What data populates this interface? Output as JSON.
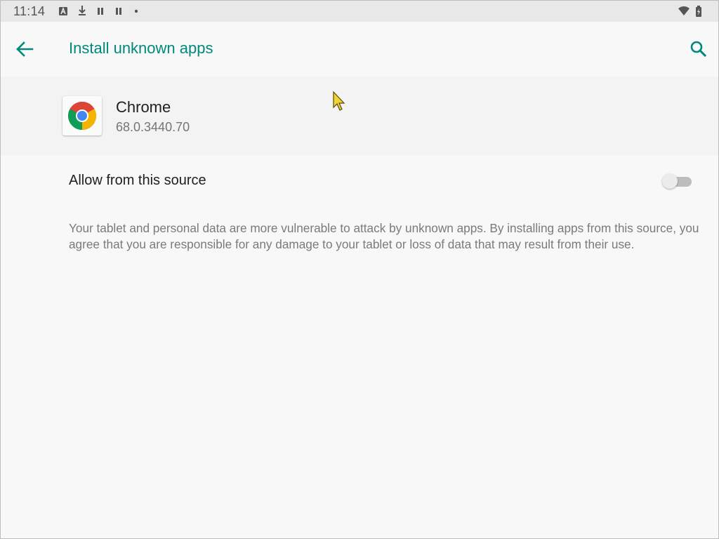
{
  "status_bar": {
    "time": "11:14",
    "icons_left": [
      "a-box-icon",
      "download-icon",
      "pause-icon",
      "pause-icon",
      "dot-icon"
    ],
    "icons_right": [
      "wifi-icon",
      "battery-icon"
    ]
  },
  "app_bar": {
    "title": "Install unknown apps",
    "back_icon": "arrow-back-icon",
    "search_icon": "search-icon",
    "accent_color": "#00897b"
  },
  "app": {
    "name": "Chrome",
    "version": "68.0.3440.70",
    "icon": "chrome-icon"
  },
  "setting": {
    "label": "Allow from this source",
    "enabled": false
  },
  "warning_text": "Your tablet and personal data are more vulnerable to attack by unknown apps. By installing apps from this source, you agree that you are responsible for any damage to your tablet or loss of data that may result from their use."
}
